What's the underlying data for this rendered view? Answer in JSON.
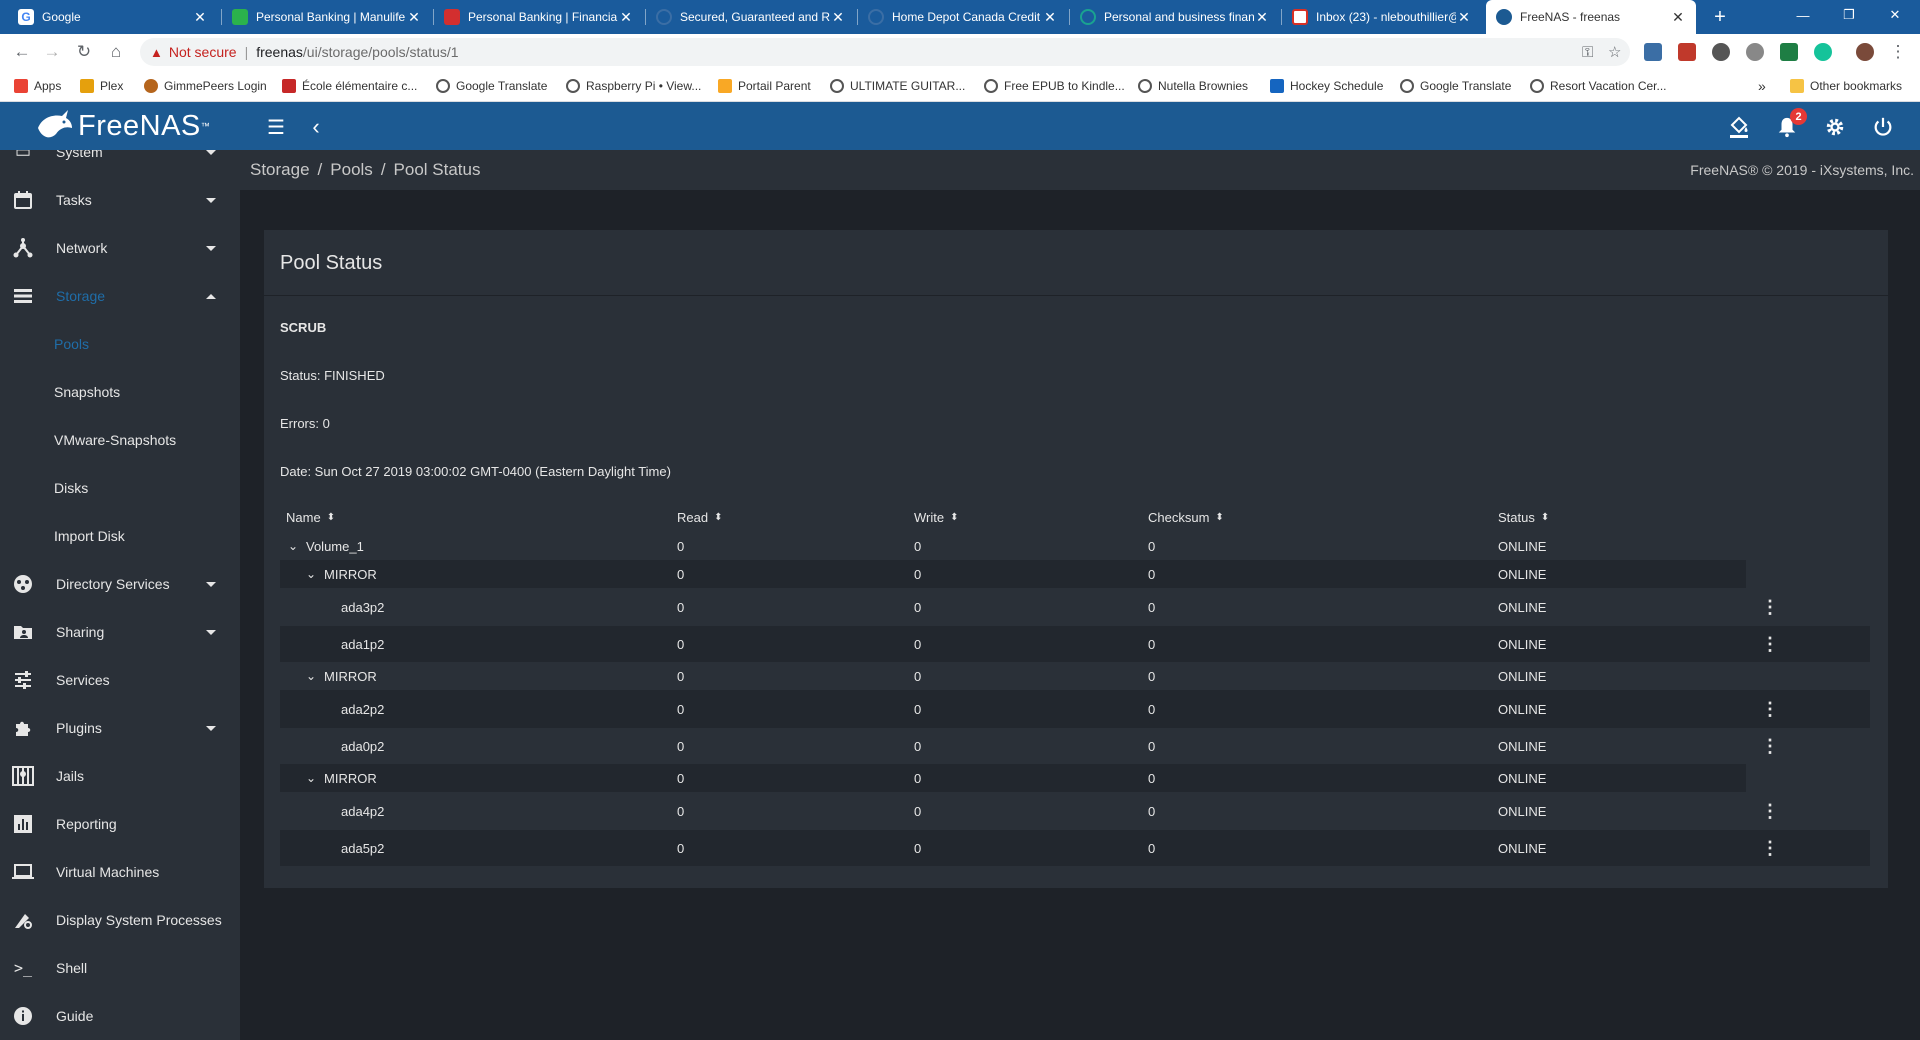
{
  "browser": {
    "tabs": [
      {
        "title": "Google",
        "color": "#ffffff"
      },
      {
        "title": "Personal Banking | Manulife",
        "color": "#2bb24c"
      },
      {
        "title": "Personal Banking | Financial",
        "color": "#d32f2f"
      },
      {
        "title": "Secured, Guaranteed and R",
        "color": "#3b6ea5"
      },
      {
        "title": "Home Depot Canada Credit",
        "color": "#3b6ea5"
      },
      {
        "title": "Personal and business finan",
        "color": "#1aa390"
      },
      {
        "title": "Inbox (23) - nlebouthillier@",
        "color": "#d93025"
      },
      {
        "title": "FreeNAS - freenas",
        "color": "#1c5a92"
      }
    ],
    "address": {
      "security_label": "Not secure",
      "host": "freenas",
      "path": "/ui/storage/pools/status/1"
    },
    "bookmarks": [
      {
        "label": "Apps",
        "color": "#ea4335"
      },
      {
        "label": "Plex",
        "color": "#e5a00d"
      },
      {
        "label": "GimmePeers Login",
        "color": "#b5651d"
      },
      {
        "label": "École élémentaire c...",
        "color": "#c62828"
      },
      {
        "label": "Google Translate",
        "color": "#555555"
      },
      {
        "label": "Raspberry Pi • View...",
        "color": "#555555"
      },
      {
        "label": "Portail Parent",
        "color": "#f9a825"
      },
      {
        "label": "ULTIMATE GUITAR...",
        "color": "#555555"
      },
      {
        "label": "Free EPUB to Kindle...",
        "color": "#555555"
      },
      {
        "label": "Nutella Brownies",
        "color": "#555555"
      },
      {
        "label": "Hockey Schedule",
        "color": "#1565c0"
      },
      {
        "label": "Google Translate",
        "color": "#555555"
      },
      {
        "label": "Resort Vacation Cer...",
        "color": "#555555"
      }
    ],
    "bookmarks_overflow": "»",
    "other_bookmarks": "Other bookmarks"
  },
  "header": {
    "logo_text": "FreeNAS",
    "notification_count": "2"
  },
  "sidebar": {
    "items": [
      {
        "label": "System",
        "icon": "system-icon"
      },
      {
        "label": "Tasks",
        "icon": "calendar-icon"
      },
      {
        "label": "Network",
        "icon": "network-icon"
      },
      {
        "label": "Storage",
        "icon": "storage-icon"
      },
      {
        "label": "Directory Services",
        "icon": "directory-icon"
      },
      {
        "label": "Sharing",
        "icon": "sharing-icon"
      },
      {
        "label": "Services",
        "icon": "services-icon"
      },
      {
        "label": "Plugins",
        "icon": "plugins-icon"
      },
      {
        "label": "Jails",
        "icon": "jails-icon"
      },
      {
        "label": "Reporting",
        "icon": "reporting-icon"
      },
      {
        "label": "Virtual Machines",
        "icon": "vm-icon"
      },
      {
        "label": "Display System Processes",
        "icon": "processes-icon"
      },
      {
        "label": "Shell",
        "icon": "shell-icon"
      },
      {
        "label": "Guide",
        "icon": "info-icon"
      }
    ],
    "storage_sub": [
      "Pools",
      "Snapshots",
      "VMware-Snapshots",
      "Disks",
      "Import Disk"
    ]
  },
  "breadcrumb": [
    "Storage",
    "Pools",
    "Pool Status"
  ],
  "copyright": "FreeNAS® © 2019 - iXsystems, Inc.",
  "pool_status": {
    "title": "Pool Status",
    "scrub_heading": "SCRUB",
    "status": "Status: FINISHED",
    "errors": "Errors: 0",
    "date": "Date: Sun Oct 27 2019 03:00:02 GMT-0400 (Eastern Daylight Time)",
    "columns": [
      "Name",
      "Read",
      "Write",
      "Checksum",
      "Status"
    ],
    "rows": [
      {
        "name": "Volume_1",
        "read": "0",
        "write": "0",
        "checksum": "0",
        "status": "ONLINE"
      },
      {
        "name": "MIRROR",
        "read": "0",
        "write": "0",
        "checksum": "0",
        "status": "ONLINE"
      },
      {
        "name": "ada3p2",
        "read": "0",
        "write": "0",
        "checksum": "0",
        "status": "ONLINE"
      },
      {
        "name": "ada1p2",
        "read": "0",
        "write": "0",
        "checksum": "0",
        "status": "ONLINE"
      },
      {
        "name": "MIRROR",
        "read": "0",
        "write": "0",
        "checksum": "0",
        "status": "ONLINE"
      },
      {
        "name": "ada2p2",
        "read": "0",
        "write": "0",
        "checksum": "0",
        "status": "ONLINE"
      },
      {
        "name": "ada0p2",
        "read": "0",
        "write": "0",
        "checksum": "0",
        "status": "ONLINE"
      },
      {
        "name": "MIRROR",
        "read": "0",
        "write": "0",
        "checksum": "0",
        "status": "ONLINE"
      },
      {
        "name": "ada4p2",
        "read": "0",
        "write": "0",
        "checksum": "0",
        "status": "ONLINE"
      },
      {
        "name": "ada5p2",
        "read": "0",
        "write": "0",
        "checksum": "0",
        "status": "ONLINE"
      }
    ]
  }
}
